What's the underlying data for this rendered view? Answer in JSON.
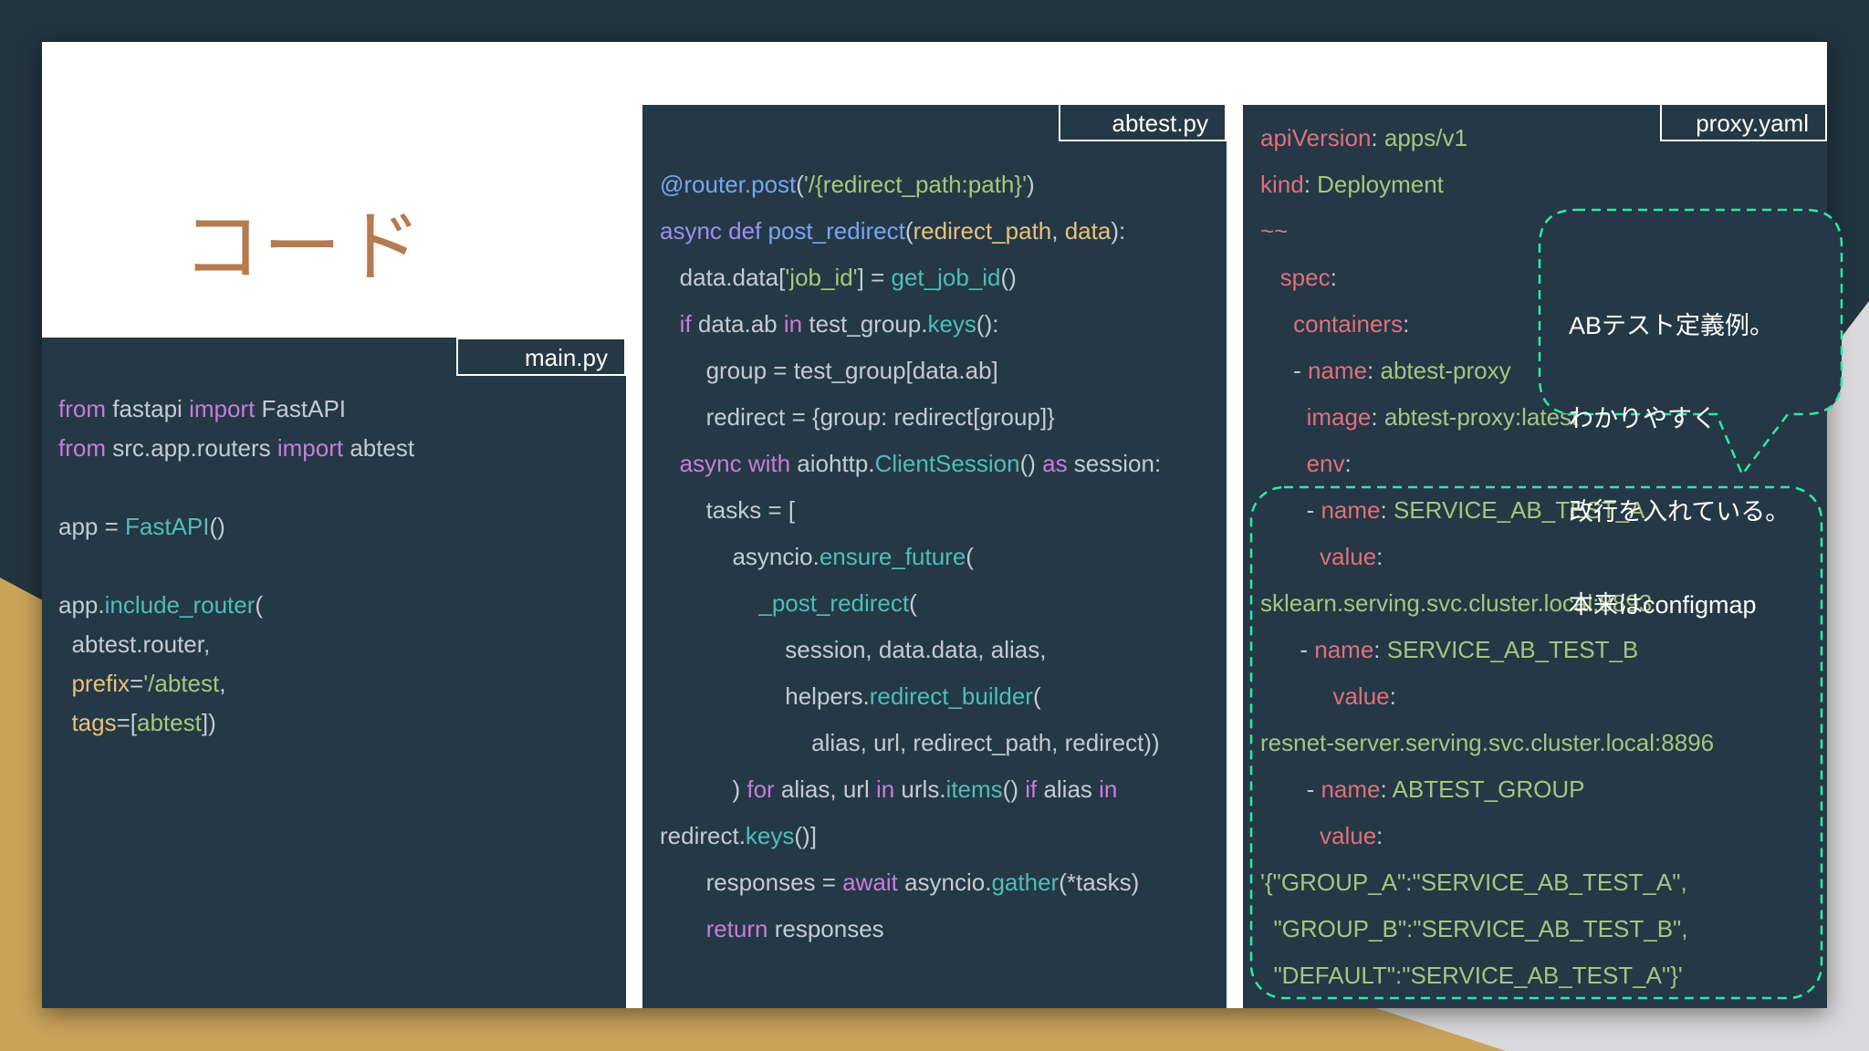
{
  "slide": {
    "title": "コード"
  },
  "colors": {
    "background": "#22343f",
    "panel": "#243846",
    "accent_gold": "#c9a35a",
    "title": "#b57b4e",
    "dashed_highlight": "#2ee8a8"
  },
  "files": {
    "main": {
      "tab": "main.py",
      "lines": [
        [
          {
            "text": "from",
            "style": "k"
          },
          {
            "text": " fastapi ",
            "style": "d"
          },
          {
            "text": "import",
            "style": "k"
          },
          {
            "text": " FastAPI",
            "style": "d"
          }
        ],
        [
          {
            "text": "from",
            "style": "k"
          },
          {
            "text": " src.app.routers ",
            "style": "d"
          },
          {
            "text": "import",
            "style": "k"
          },
          {
            "text": " abtest",
            "style": "d"
          }
        ],
        [],
        [
          {
            "text": "app = ",
            "style": "d"
          },
          {
            "text": "FastAPI",
            "style": "t"
          },
          {
            "text": "()",
            "style": "d"
          }
        ],
        [],
        [
          {
            "text": "app.",
            "style": "d"
          },
          {
            "text": "include_router",
            "style": "t"
          },
          {
            "text": "(",
            "style": "d"
          }
        ],
        [
          {
            "text": "  abtest.router,",
            "style": "d"
          }
        ],
        [
          {
            "text": "  prefix",
            "style": "p"
          },
          {
            "text": "=",
            "style": "d"
          },
          {
            "text": "'/abtest",
            "style": "s"
          },
          {
            "text": ",",
            "style": "d"
          }
        ],
        [
          {
            "text": "  tags",
            "style": "p"
          },
          {
            "text": "=[",
            "style": "d"
          },
          {
            "text": "abtest",
            "style": "s"
          },
          {
            "text": "])",
            "style": "d"
          }
        ]
      ]
    },
    "abtest": {
      "tab": "abtest.py",
      "lines": [
        [
          {
            "text": "@router.post",
            "style": "f"
          },
          {
            "text": "(",
            "style": "d"
          },
          {
            "text": "'/{redirect_path:path}'",
            "style": "s"
          },
          {
            "text": ")",
            "style": "d"
          }
        ],
        [
          {
            "text": "async def ",
            "style": "l"
          },
          {
            "text": "post_redirect",
            "style": "f"
          },
          {
            "text": "(",
            "style": "d"
          },
          {
            "text": "redirect_path",
            "style": "p"
          },
          {
            "text": ", ",
            "style": "d"
          },
          {
            "text": "data",
            "style": "p"
          },
          {
            "text": "):",
            "style": "d"
          }
        ],
        [
          {
            "text": "   data.data[",
            "style": "d"
          },
          {
            "text": "'job_id'",
            "style": "s"
          },
          {
            "text": "] = ",
            "style": "d"
          },
          {
            "text": "get_job_id",
            "style": "t"
          },
          {
            "text": "()",
            "style": "d"
          }
        ],
        [
          {
            "text": "   if",
            "style": "k"
          },
          {
            "text": " data.ab ",
            "style": "d"
          },
          {
            "text": "in",
            "style": "k"
          },
          {
            "text": " test_group.",
            "style": "d"
          },
          {
            "text": "keys",
            "style": "t"
          },
          {
            "text": "():",
            "style": "d"
          }
        ],
        [
          {
            "text": "       group = test_group[data.ab]",
            "style": "d"
          }
        ],
        [
          {
            "text": "       redirect = {group: redirect[group]}",
            "style": "d"
          }
        ],
        [
          {
            "text": "   async with",
            "style": "k"
          },
          {
            "text": " aiohttp.",
            "style": "d"
          },
          {
            "text": "ClientSession",
            "style": "t"
          },
          {
            "text": "() ",
            "style": "d"
          },
          {
            "text": "as",
            "style": "k"
          },
          {
            "text": " session:",
            "style": "d"
          }
        ],
        [
          {
            "text": "       tasks = [",
            "style": "d"
          }
        ],
        [
          {
            "text": "           asyncio.",
            "style": "d"
          },
          {
            "text": "ensure_future",
            "style": "t"
          },
          {
            "text": "(",
            "style": "d"
          }
        ],
        [
          {
            "text": "               _post_redirect",
            "style": "t"
          },
          {
            "text": "(",
            "style": "d"
          }
        ],
        [
          {
            "text": "                   session, data.data, alias,",
            "style": "d"
          }
        ],
        [
          {
            "text": "                   helpers.",
            "style": "d"
          },
          {
            "text": "redirect_builder",
            "style": "t"
          },
          {
            "text": "(",
            "style": "d"
          }
        ],
        [
          {
            "text": "                       alias, url, redirect_path, redirect))",
            "style": "d"
          }
        ],
        [
          {
            "text": "           ) ",
            "style": "d"
          },
          {
            "text": "for",
            "style": "k"
          },
          {
            "text": " alias, url ",
            "style": "d"
          },
          {
            "text": "in",
            "style": "k"
          },
          {
            "text": " urls.",
            "style": "d"
          },
          {
            "text": "items",
            "style": "t"
          },
          {
            "text": "() ",
            "style": "d"
          },
          {
            "text": "if",
            "style": "k"
          },
          {
            "text": " alias ",
            "style": "d"
          },
          {
            "text": "in",
            "style": "k"
          }
        ],
        [
          {
            "text": "redirect.",
            "style": "d"
          },
          {
            "text": "keys",
            "style": "t"
          },
          {
            "text": "()]",
            "style": "d"
          }
        ],
        [
          {
            "text": "       responses = ",
            "style": "d"
          },
          {
            "text": "await",
            "style": "k"
          },
          {
            "text": " asyncio.",
            "style": "d"
          },
          {
            "text": "gather",
            "style": "t"
          },
          {
            "text": "(*tasks)",
            "style": "d"
          }
        ],
        [
          {
            "text": "       return",
            "style": "k"
          },
          {
            "text": " responses",
            "style": "d"
          }
        ]
      ]
    },
    "proxy": {
      "tab": "proxy.yaml",
      "lines": [
        [
          {
            "text": "apiVersion",
            "style": "r"
          },
          {
            "text": ": ",
            "style": "d"
          },
          {
            "text": "apps/v1",
            "style": "g"
          }
        ],
        [
          {
            "text": "kind",
            "style": "r"
          },
          {
            "text": ": ",
            "style": "d"
          },
          {
            "text": "Deployment",
            "style": "g"
          }
        ],
        [
          {
            "text": "~~",
            "style": "r"
          }
        ],
        [
          {
            "text": "   spec",
            "style": "r"
          },
          {
            "text": ":",
            "style": "d"
          }
        ],
        [
          {
            "text": "     containers",
            "style": "r"
          },
          {
            "text": ":",
            "style": "d"
          }
        ],
        [
          {
            "text": "     - ",
            "style": "d"
          },
          {
            "text": "name",
            "style": "r"
          },
          {
            "text": ": ",
            "style": "d"
          },
          {
            "text": "abtest-proxy",
            "style": "g"
          }
        ],
        [
          {
            "text": "       image",
            "style": "r"
          },
          {
            "text": ": ",
            "style": "d"
          },
          {
            "text": "abtest-proxy:latest",
            "style": "g"
          }
        ],
        [
          {
            "text": "       env",
            "style": "r"
          },
          {
            "text": ":",
            "style": "d"
          }
        ],
        [
          {
            "text": "       - ",
            "style": "d"
          },
          {
            "text": "name",
            "style": "r"
          },
          {
            "text": ": ",
            "style": "d"
          },
          {
            "text": "SERVICE_AB_TEST_A",
            "style": "g"
          }
        ],
        [
          {
            "text": "         value",
            "style": "r"
          },
          {
            "text": ":",
            "style": "d"
          }
        ],
        [
          {
            "text": "sklearn.serving.svc.cluster.local:8893",
            "style": "g"
          }
        ],
        [
          {
            "text": "      - ",
            "style": "d"
          },
          {
            "text": "name",
            "style": "r"
          },
          {
            "text": ": ",
            "style": "d"
          },
          {
            "text": "SERVICE_AB_TEST_B",
            "style": "g"
          }
        ],
        [
          {
            "text": "           value",
            "style": "r"
          },
          {
            "text": ":",
            "style": "d"
          }
        ],
        [
          {
            "text": "resnet-server.serving.svc.cluster.local:8896",
            "style": "g"
          }
        ],
        [
          {
            "text": "       - ",
            "style": "d"
          },
          {
            "text": "name",
            "style": "r"
          },
          {
            "text": ": ",
            "style": "d"
          },
          {
            "text": "ABTEST_GROUP",
            "style": "g"
          }
        ],
        [
          {
            "text": "         value",
            "style": "r"
          },
          {
            "text": ":",
            "style": "d"
          }
        ],
        [
          {
            "text": "'{\"GROUP_A\":\"SERVICE_AB_TEST_A\",",
            "style": "g"
          }
        ],
        [
          {
            "text": "  \"GROUP_B\":\"SERVICE_AB_TEST_B\",",
            "style": "g"
          }
        ],
        [
          {
            "text": "  \"DEFAULT\":\"SERVICE_AB_TEST_A\"}'",
            "style": "g"
          }
        ]
      ]
    }
  },
  "callout": {
    "lines": [
      "ABテスト定義例。",
      "わかりやすく",
      "改行を入れている。",
      "本来はconfigmap"
    ]
  }
}
